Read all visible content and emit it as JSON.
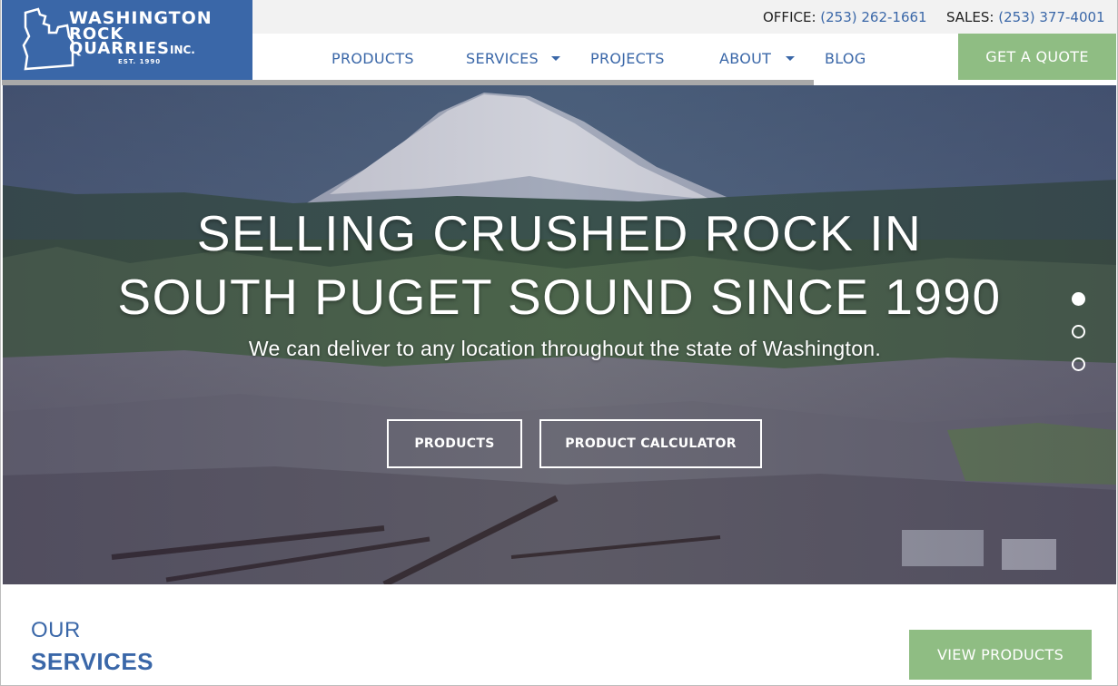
{
  "logo": {
    "line1": "WASHINGTON",
    "line2": "ROCK",
    "line3": "QUARRIES",
    "inc": "INC.",
    "est": "EST. 1990"
  },
  "contact": {
    "office_label": "OFFICE:",
    "office_phone": "(253) 262-1661",
    "sales_label": "SALES:",
    "sales_phone": "(253) 377-4001"
  },
  "nav": {
    "items": [
      {
        "label": "PRODUCTS",
        "dropdown": false
      },
      {
        "label": "SERVICES",
        "dropdown": true
      },
      {
        "label": "PROJECTS",
        "dropdown": false
      },
      {
        "label": "ABOUT",
        "dropdown": true
      },
      {
        "label": "BLOG",
        "dropdown": false
      }
    ],
    "quote_label": "GET A QUOTE"
  },
  "hero": {
    "headline_line1": "SELLING CRUSHED ROCK IN",
    "headline_line2": "SOUTH PUGET SOUND SINCE 1990",
    "subtext": "We can deliver to any location throughout the state of Washington.",
    "buttons": {
      "products": "PRODUCTS",
      "calculator": "PRODUCT CALCULATOR"
    },
    "slider": {
      "slide_count": 3,
      "active_slide": 1
    }
  },
  "services": {
    "our": "OUR",
    "title": "SERVICES",
    "view_products": "VIEW PRODUCTS"
  },
  "colors": {
    "brand_blue": "#3a67a8",
    "accent_green": "#8fbd83",
    "topbar_bg": "#f2f2f2"
  }
}
